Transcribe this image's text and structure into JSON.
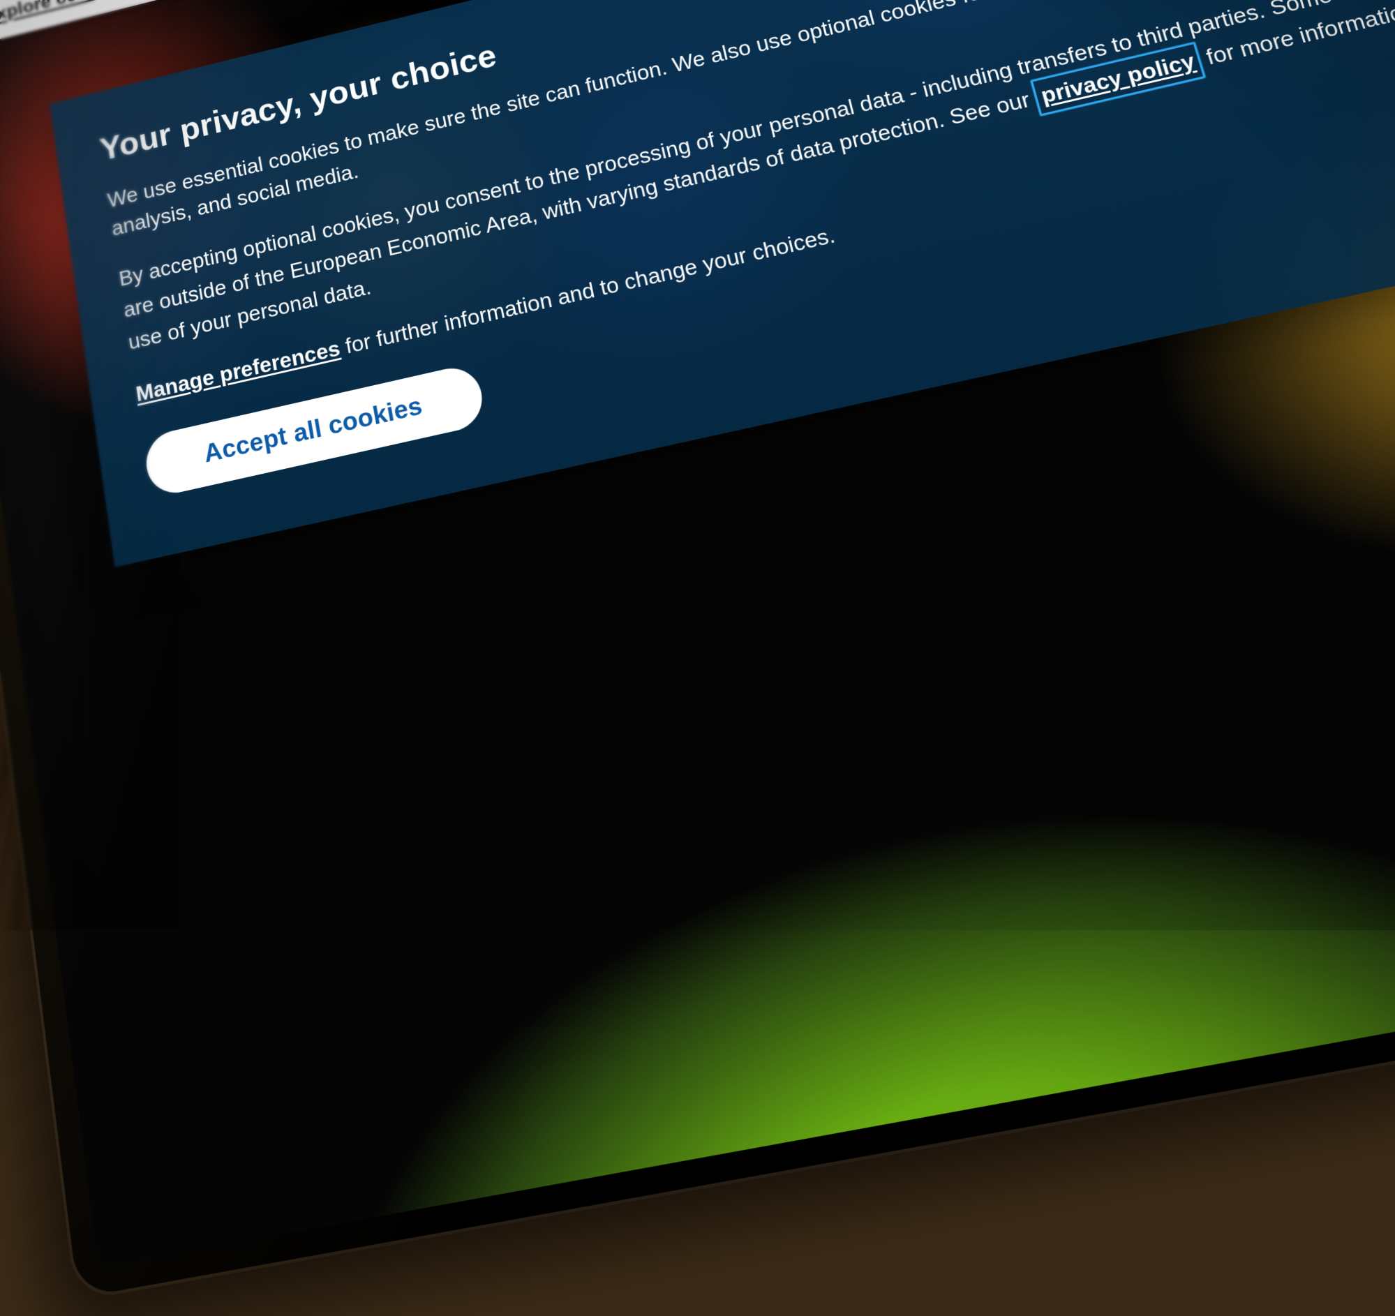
{
  "topcard": {
    "explore_label": "Explore content"
  },
  "banner": {
    "title": "Your privacy, your choice",
    "p1": "We use essential cookies to make sure the site can function. We also use optional cookies for advertising, personalisation of content, usage analysis, and social media.",
    "p2_before": "By accepting optional cookies, you consent to the processing of your personal data - including transfers to third parties. Some third parties are outside of the European Economic Area, with varying standards of data protection. See our ",
    "privacy_policy_label": "privacy policy",
    "p2_after": " for more information on the use of your personal data.",
    "manage_label": "Manage preferences",
    "manage_after": " for further information and to change your choices.",
    "accept_label": "Accept all cookies"
  }
}
